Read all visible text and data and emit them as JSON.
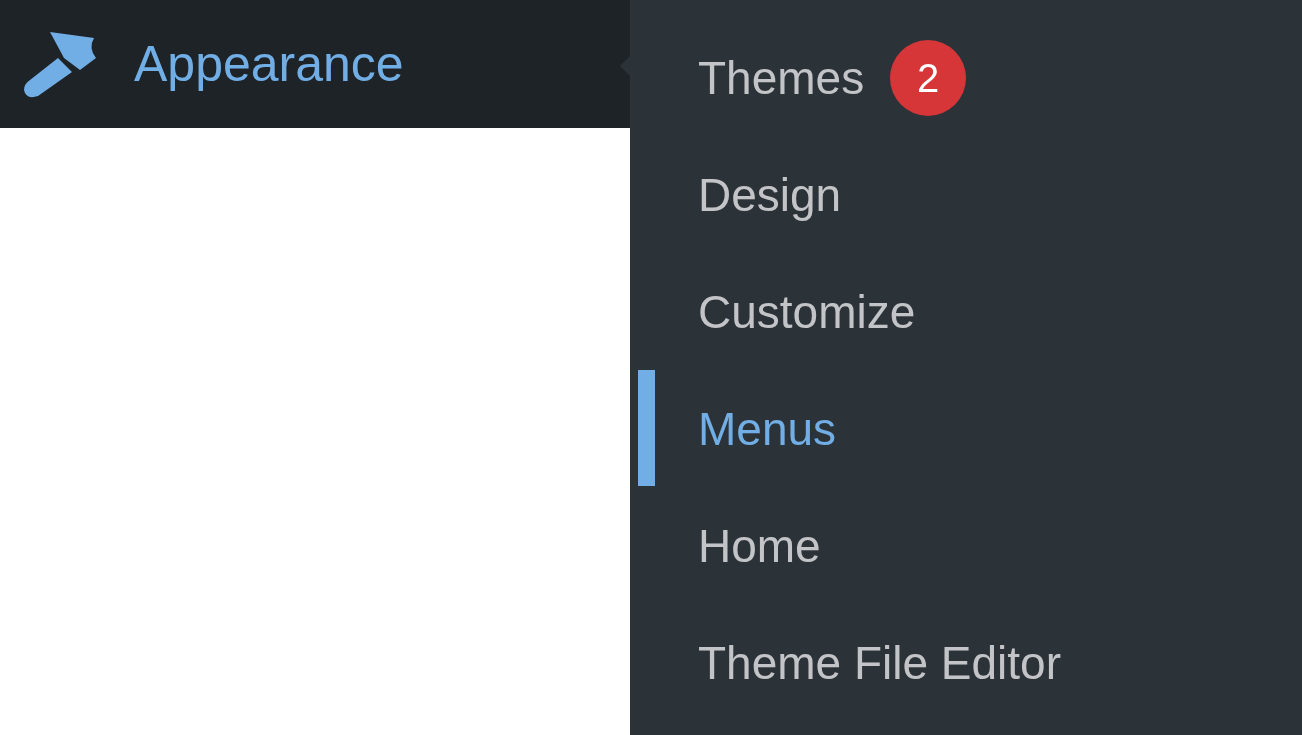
{
  "menu": {
    "label": "Appearance",
    "selected": true
  },
  "submenu": [
    {
      "label": "Themes",
      "selected": false,
      "badge": "2"
    },
    {
      "label": "Design",
      "selected": false
    },
    {
      "label": "Customize",
      "selected": false
    },
    {
      "label": "Menus",
      "selected": true
    },
    {
      "label": "Home",
      "selected": false
    },
    {
      "label": "Theme File Editor",
      "selected": false
    }
  ]
}
